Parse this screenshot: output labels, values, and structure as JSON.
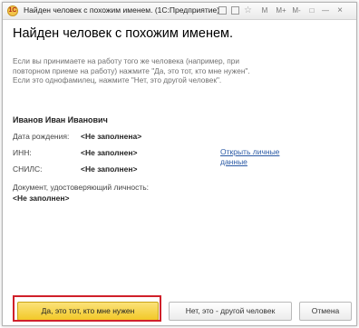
{
  "window": {
    "title": "Найден человек с похожим именем. (1С:Предприятие)",
    "logo_text": "1C",
    "controls": [
      "M",
      "M+",
      "M-",
      "□",
      "—",
      "×"
    ]
  },
  "heading": "Найден человек с похожим именем.",
  "info": {
    "line1": "Если вы принимаете на работу того же человека (например, при повторном приеме на работу) нажмите \"Да, это тот, кто мне нужен\".",
    "line2": "Если это однофамилец, нажмите \"Нет, это другой человек\"."
  },
  "person": {
    "name": "Иванов Иван Иванович",
    "birth_label": "Дата рождения:",
    "birth_value": "<Не заполнена>",
    "inn_label": "ИНН:",
    "inn_value": "<Не заполнен>",
    "snils_label": "СНИЛС:",
    "snils_value": "<Не заполнен>",
    "doc_label": "Документ, удостоверяющий личность:",
    "doc_value": "<Не заполнен>",
    "open_link": "Открыть личные данные"
  },
  "buttons": {
    "yes": "Да, это тот, кто мне нужен",
    "no": "Нет, это - другой человек",
    "cancel": "Отмена"
  },
  "colors": {
    "primary_button": "#f2c928",
    "highlight": "#d0202a",
    "link": "#2b5aa5"
  }
}
